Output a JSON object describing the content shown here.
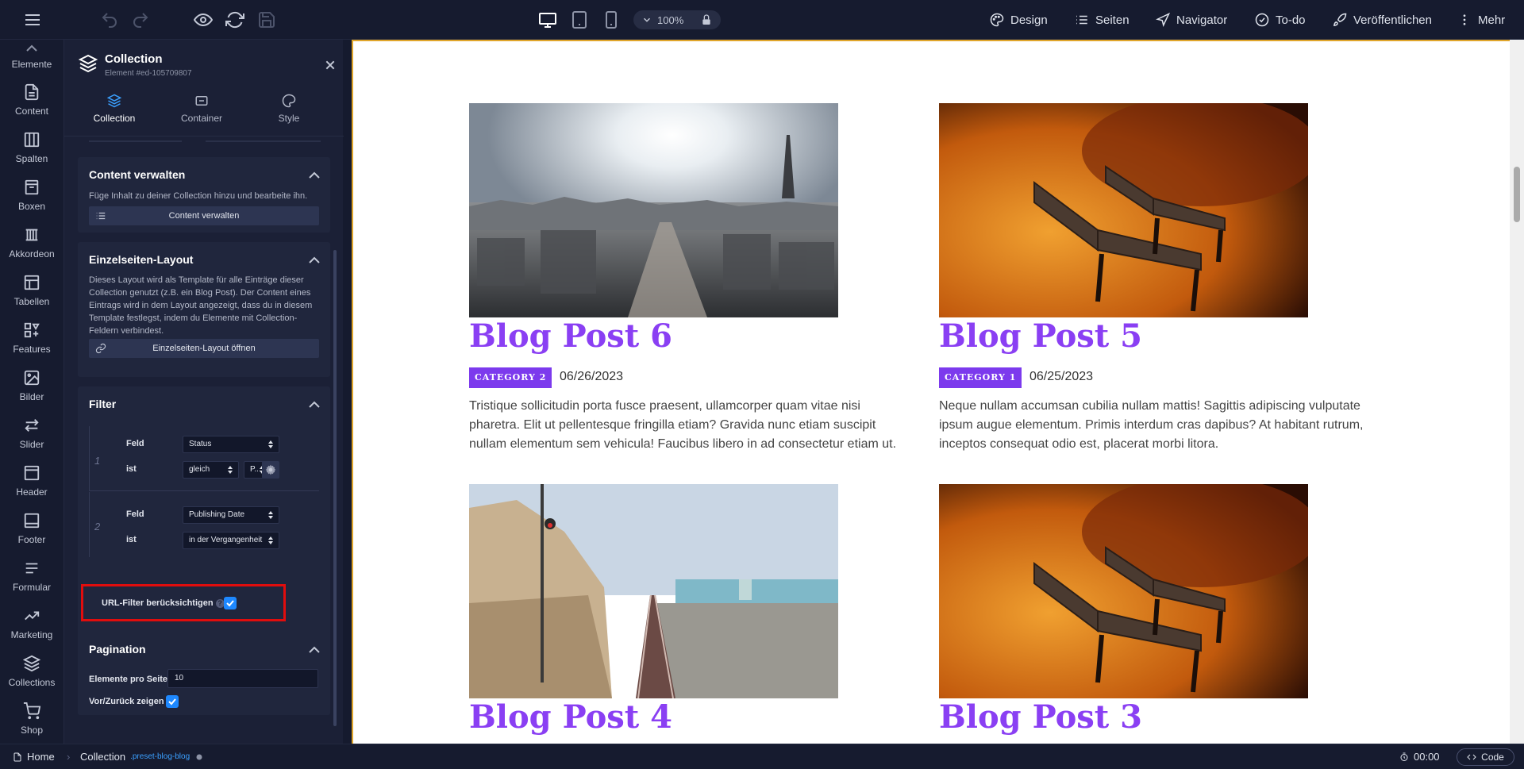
{
  "topbar": {
    "zoom": "100%",
    "nav": [
      {
        "label": "Design",
        "icon": "palette-icon"
      },
      {
        "label": "Seiten",
        "icon": "list-icon"
      },
      {
        "label": "Navigator",
        "icon": "navigator-icon"
      },
      {
        "label": "To-do",
        "icon": "check-circle-icon"
      },
      {
        "label": "Veröffentlichen",
        "icon": "rocket-icon"
      },
      {
        "label": "Mehr",
        "icon": "more-vertical-icon"
      }
    ]
  },
  "rail": {
    "items": [
      {
        "label": "Elemente",
        "icon": "elements-icon"
      },
      {
        "label": "Content",
        "icon": "document-icon"
      },
      {
        "label": "Spalten",
        "icon": "columns-icon"
      },
      {
        "label": "Boxen",
        "icon": "box-icon"
      },
      {
        "label": "Akkordeon",
        "icon": "accordion-icon"
      },
      {
        "label": "Tabellen",
        "icon": "table-icon"
      },
      {
        "label": "Features",
        "icon": "features-icon"
      },
      {
        "label": "Bilder",
        "icon": "image-icon"
      },
      {
        "label": "Slider",
        "icon": "slider-icon"
      },
      {
        "label": "Header",
        "icon": "header-icon"
      },
      {
        "label": "Footer",
        "icon": "footer-icon"
      },
      {
        "label": "Formular",
        "icon": "form-icon"
      },
      {
        "label": "Marketing",
        "icon": "marketing-icon"
      },
      {
        "label": "Collections",
        "icon": "collections-icon"
      },
      {
        "label": "Shop",
        "icon": "cart-icon"
      }
    ]
  },
  "panel": {
    "title": "Collection",
    "element_id": "Element #ed-105709807",
    "tabs": [
      {
        "label": "Collection",
        "icon": "layers-icon",
        "active": true
      },
      {
        "label": "Container",
        "icon": "container-icon",
        "active": false
      },
      {
        "label": "Style",
        "icon": "palette-icon",
        "active": false
      }
    ],
    "content_section": {
      "heading": "Content verwalten",
      "text": "Füge Inhalt zu deiner Collection hinzu und bearbeite ihn.",
      "button": "Content verwalten"
    },
    "layout_section": {
      "heading": "Einzelseiten-Layout",
      "text": "Dieses Layout wird als Template für alle Einträge dieser Collection genutzt (z.B. ein Blog Post). Der Content eines Eintrags wird in dem Layout angezeigt, dass du in diesem Template festlegst, indem du Elemente mit Collection-Feldern verbindest.",
      "button": "Einzelseiten-Layout öffnen"
    },
    "filter_section": {
      "heading": "Filter",
      "filters": [
        {
          "num": "1",
          "feld_label": "Feld",
          "feld_value": "Status",
          "ist_label": "ist",
          "op_value": "gleich",
          "val_value": "P..."
        },
        {
          "num": "2",
          "feld_label": "Feld",
          "feld_value": "Publishing Date",
          "ist_label": "ist",
          "op_value": "in der Vergangenheit"
        }
      ],
      "url_filter_label": "URL-Filter berücksichtigen",
      "url_filter_checked": true
    },
    "pagination_section": {
      "heading": "Pagination",
      "per_page_label": "Elemente pro Seite",
      "per_page_value": "10",
      "prev_next_label": "Vor/Zurück zeigen",
      "prev_next_checked": true
    }
  },
  "posts": [
    {
      "title": "Blog Post 6",
      "category": "Category 2",
      "date": "06/26/2023",
      "excerpt": "Tristique sollicitudin porta fusce praesent, ullamcorper quam vitae nisi pharetra. Elit ut pellentesque fringilla etiam? Gravida nunc etiam suscipit nullam elementum sem vehicula! Faucibus libero in ad consectetur etiam ut.",
      "image": "city-skyline-photo"
    },
    {
      "title": "Blog Post 5",
      "category": "Category 1",
      "date": "06/25/2023",
      "excerpt": "Neque nullam accumsan cubilia nullam mattis! Sagittis adipiscing vulputate ipsum augue elementum. Primis interdum cras dapibus? At habitant rutrum, inceptos consequat odio est, placerat morbi litora.",
      "image": "autumn-bench-photo"
    },
    {
      "title": "Blog Post 4",
      "image": "railway-beach-photo"
    },
    {
      "title": "Blog Post 3",
      "image": "autumn-bench-photo"
    }
  ],
  "statusbar": {
    "home": "Home",
    "collection": "Collection",
    "class_name": ".preset-blog-blog",
    "time": "00:00",
    "code": "Code"
  },
  "colors": {
    "accent_blue": "#1e88ff",
    "post_title": "#8a3ff3",
    "category_badge": "#7c3aed",
    "highlight_box": "#e00d0d",
    "canvas_border": "#e0a52a"
  }
}
